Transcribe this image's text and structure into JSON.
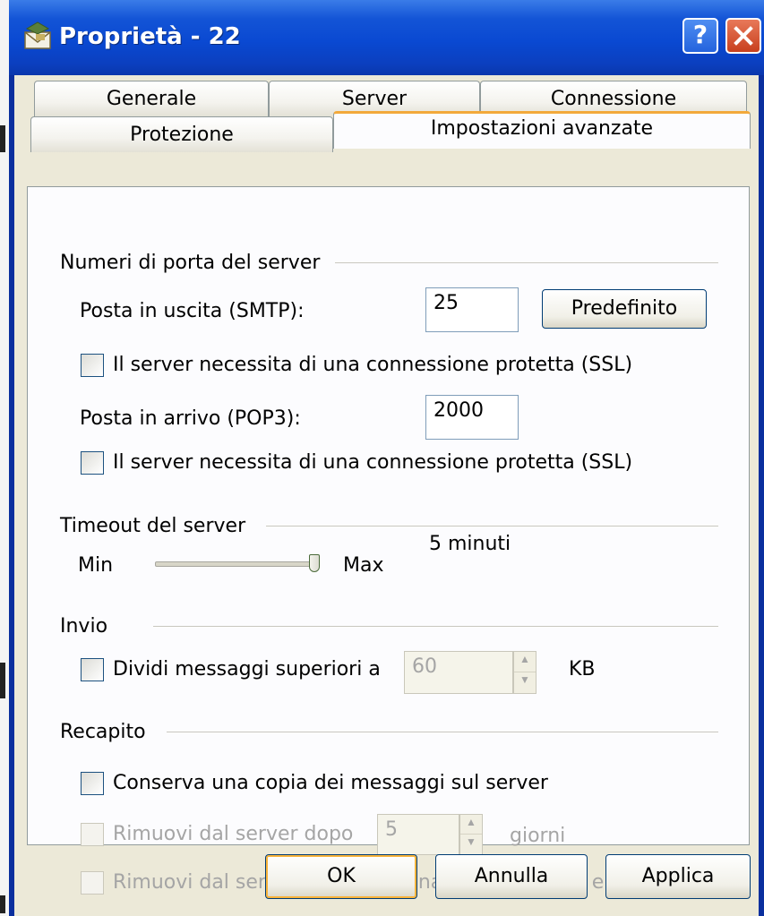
{
  "window": {
    "title": "Proprietà - 22",
    "help_label": "?",
    "close_label": "✕"
  },
  "tabs": {
    "row1": [
      "Generale",
      "Server",
      "Connessione"
    ],
    "row2": [
      "Protezione",
      "Impostazioni avanzate"
    ],
    "active": "Impostazioni avanzate"
  },
  "ports": {
    "group_label": "Numeri di porta del server",
    "smtp_label": "Posta in uscita (SMTP):",
    "smtp_value": "25",
    "default_button": "Predefinito",
    "smtp_ssl_label": "Il server necessita di una connessione protetta (SSL)",
    "pop3_label": "Posta in arrivo (POP3):",
    "pop3_value": "2000",
    "pop3_ssl_label": "Il server necessita di una connessione protetta (SSL)"
  },
  "timeout": {
    "group_label": "Timeout del server",
    "min_label": "Min",
    "max_label": "Max",
    "value_label": "5 minuti",
    "slider_level": 1.0
  },
  "sending": {
    "group_label": "Invio",
    "split_label": "Dividi messaggi superiori a",
    "split_value": "60",
    "unit": "KB"
  },
  "delivery": {
    "group_label": "Recapito",
    "keep_copy_label": "Conserva una copia dei messaggi sul server",
    "remove_after_label": "Rimuovi dal server dopo",
    "remove_after_value": "5",
    "days_unit": "giorni",
    "remove_deleted_label": "Rimuovi dal server dopo l'eliminazione da Posta eliminata"
  },
  "buttons": {
    "ok": "OK",
    "cancel": "Annulla",
    "apply": "Applica"
  }
}
